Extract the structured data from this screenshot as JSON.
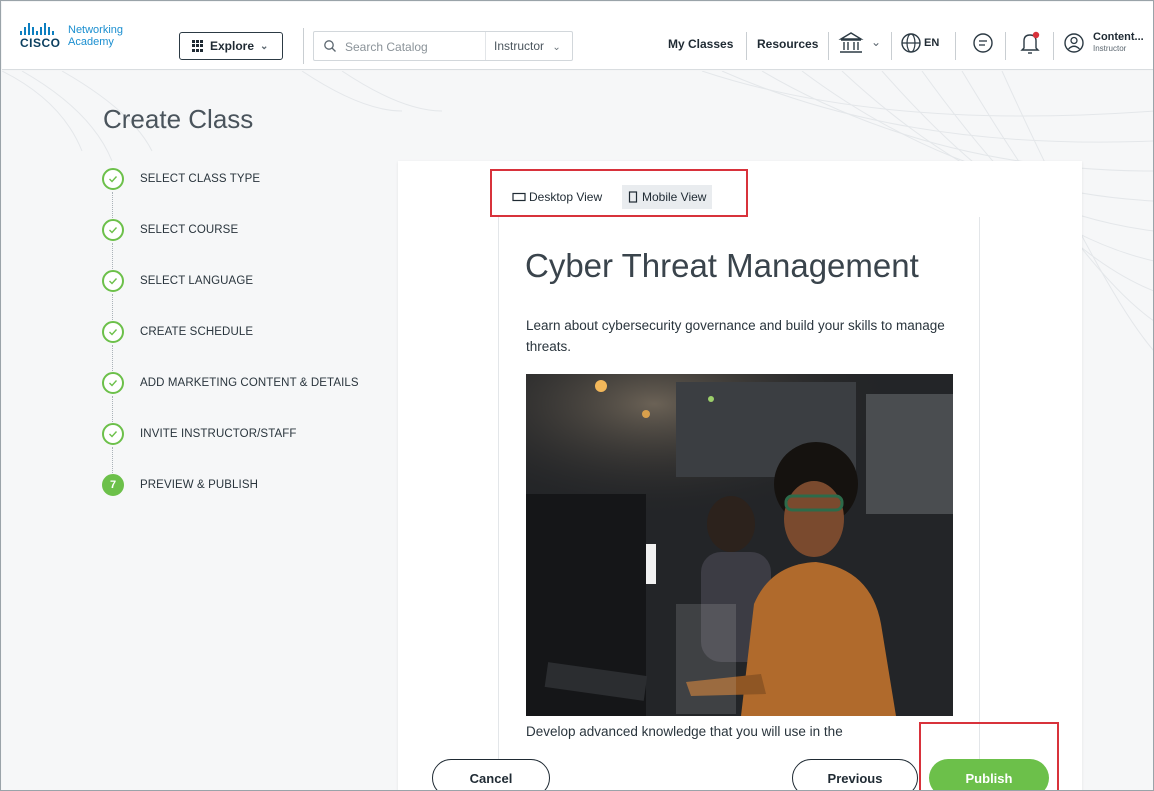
{
  "header": {
    "logo_line1": "Networking",
    "logo_line2": "Academy",
    "logo_brand": "CISCO",
    "explore_label": "Explore",
    "search_placeholder": "Search Catalog",
    "search_role": "Instructor",
    "nav_my_classes": "My Classes",
    "nav_resources": "Resources",
    "language": "EN",
    "user_name": "Content...",
    "user_role": "Instructor",
    "icons": [
      "grid-icon",
      "search-icon",
      "institution-icon",
      "chevron-down-icon",
      "globe-icon",
      "chat-icon",
      "bell-icon",
      "user-icon"
    ]
  },
  "page": {
    "title": "Create Class"
  },
  "steps": [
    {
      "number": "1",
      "label": "SELECT CLASS TYPE",
      "status": "complete"
    },
    {
      "number": "2",
      "label": "SELECT COURSE",
      "status": "complete"
    },
    {
      "number": "3",
      "label": "SELECT LANGUAGE",
      "status": "complete"
    },
    {
      "number": "4",
      "label": "CREATE SCHEDULE",
      "status": "complete"
    },
    {
      "number": "5",
      "label": "ADD MARKETING CONTENT & DETAILS",
      "status": "complete"
    },
    {
      "number": "6",
      "label": "INVITE INSTRUCTOR/STAFF",
      "status": "complete"
    },
    {
      "number": "7",
      "label": "PREVIEW & PUBLISH",
      "status": "active"
    }
  ],
  "preview": {
    "desktop_view_label": "Desktop View",
    "mobile_view_label": "Mobile View",
    "selected_view": "Mobile View",
    "course_title": "Cyber Threat Management",
    "course_description": "Learn about cybersecurity governance and build your skills to manage threats.",
    "course_more_text": "Develop advanced knowledge that you will use in the"
  },
  "actions": {
    "cancel_label": "Cancel",
    "previous_label": "Previous",
    "publish_label": "Publish"
  },
  "colors": {
    "accent_green": "#6cc04a",
    "highlight_red": "#d8323b",
    "brand_blue": "#1b8fd0"
  }
}
